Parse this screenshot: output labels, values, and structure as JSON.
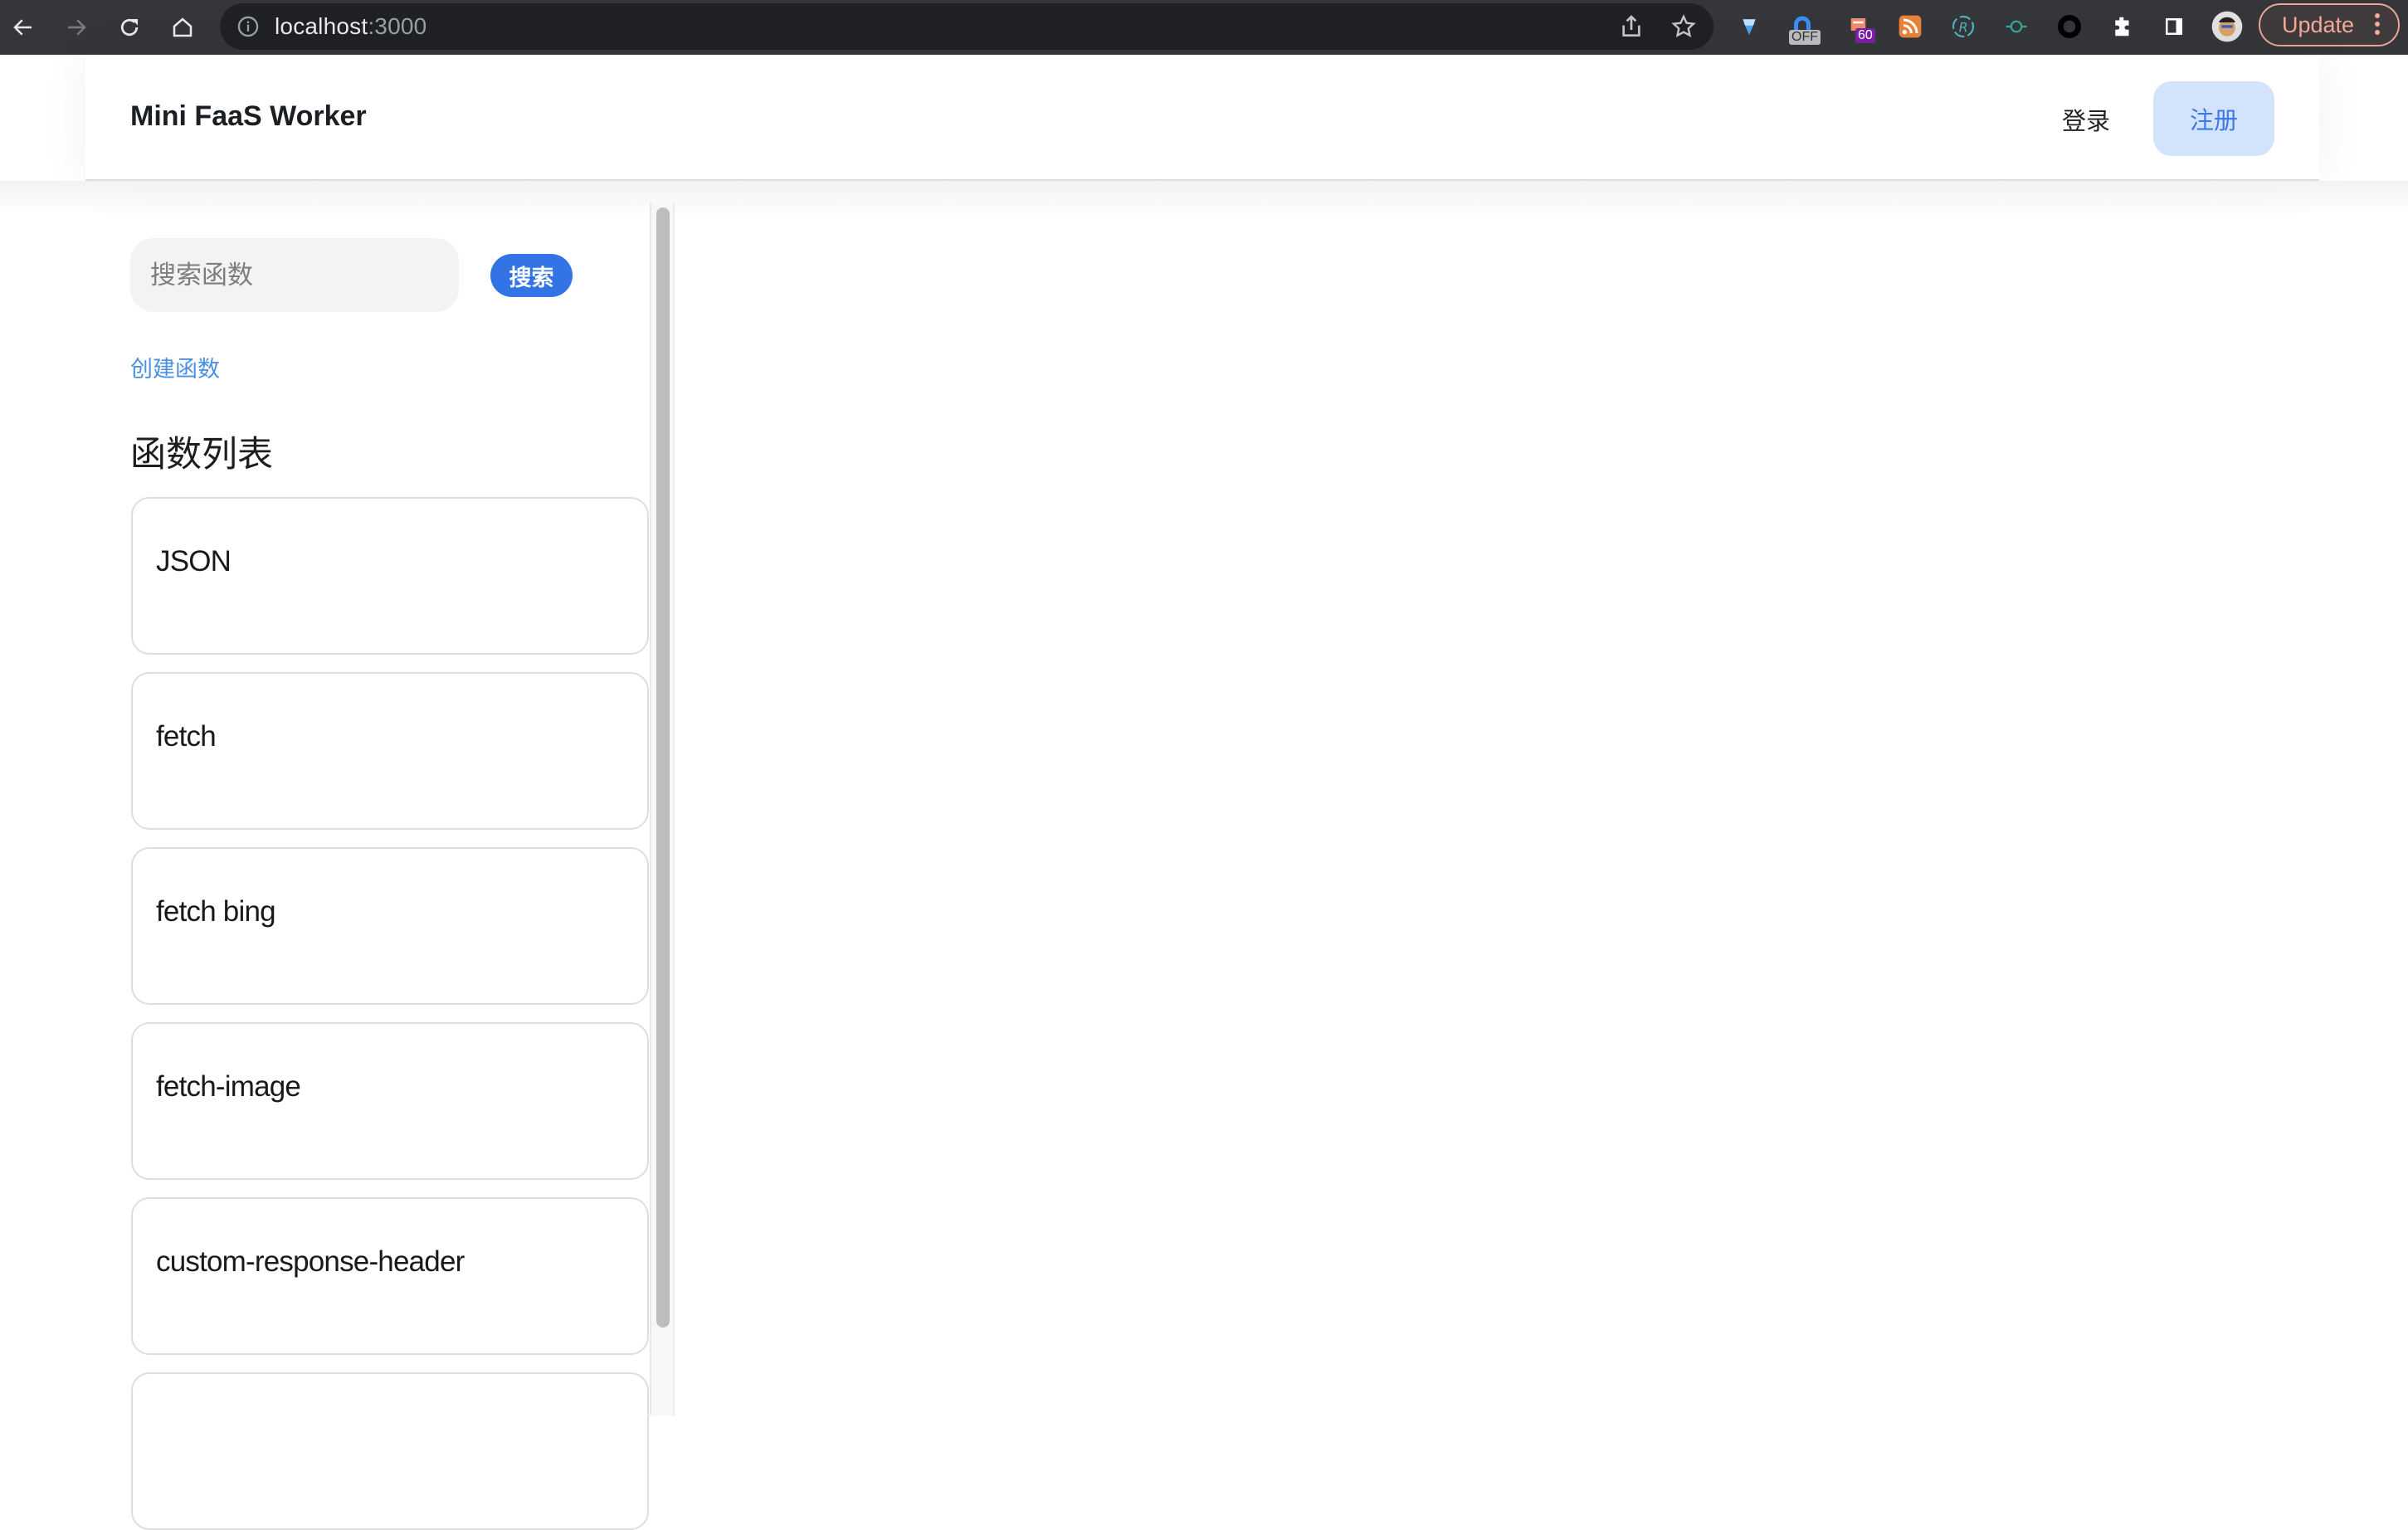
{
  "browser": {
    "url_host": "localhost",
    "url_port": ":3000",
    "update_label": "Update",
    "extensions": [
      {
        "name": "diamond-extension-icon"
      },
      {
        "name": "off-extension-icon",
        "badge": "OFF"
      },
      {
        "name": "tab-extension-icon",
        "badge": "60"
      },
      {
        "name": "rss-extension-icon"
      },
      {
        "name": "r-refresh-extension-icon"
      },
      {
        "name": "git-commit-extension-icon"
      },
      {
        "name": "ring-extension-icon"
      },
      {
        "name": "puzzle-extensions-icon"
      },
      {
        "name": "side-panel-icon"
      },
      {
        "name": "profile-avatar"
      }
    ]
  },
  "header": {
    "title": "Mini FaaS Worker",
    "login_label": "登录",
    "register_label": "注册"
  },
  "sidebar": {
    "search_placeholder": "搜索函数",
    "search_value": "",
    "search_button_label": "搜索",
    "create_link_label": "创建函数",
    "list_heading": "函数列表",
    "functions": [
      {
        "name": "JSON"
      },
      {
        "name": "fetch"
      },
      {
        "name": "fetch bing"
      },
      {
        "name": "fetch-image"
      },
      {
        "name": "custom-response-header"
      },
      {
        "name": ""
      }
    ]
  },
  "colors": {
    "accent": "#3273e6",
    "link": "#4a90e2",
    "register_bg": "#d3e3fb",
    "register_text": "#3b78e7",
    "input_bg": "#f2f3f5"
  }
}
